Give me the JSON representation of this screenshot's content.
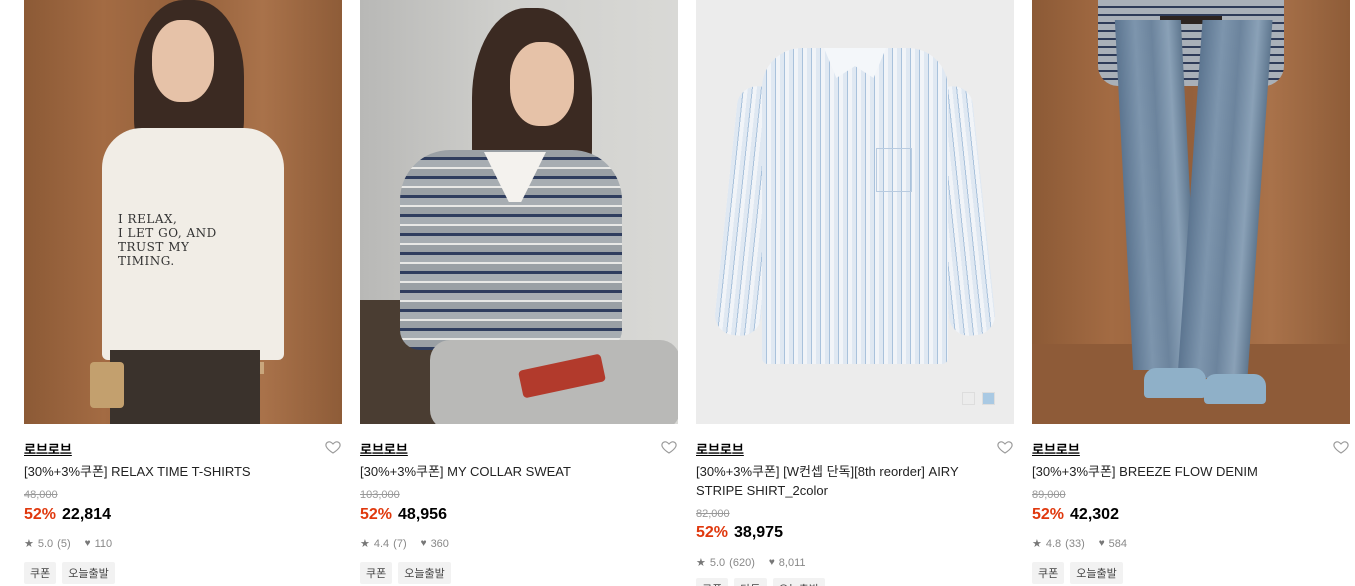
{
  "products": [
    {
      "brand": "로브로브",
      "title": "[30%+3%쿠폰] RELAX TIME T-SHIRTS",
      "original_price": "48,000",
      "discount": "52%",
      "sale_price": "22,814",
      "rating": "5.0",
      "reviews": "(5)",
      "likes": "110",
      "tags": [
        "쿠폰",
        "오늘출발"
      ],
      "print_text": "I RELAX,\nI LET GO, AND\nTRUST MY\nTIMING."
    },
    {
      "brand": "로브로브",
      "title": "[30%+3%쿠폰] MY COLLAR SWEAT",
      "original_price": "103,000",
      "discount": "52%",
      "sale_price": "48,956",
      "rating": "4.4",
      "reviews": "(7)",
      "likes": "360",
      "tags": [
        "쿠폰",
        "오늘출발"
      ]
    },
    {
      "brand": "로브로브",
      "title": "[30%+3%쿠폰] [W컨셉 단독][8th reorder] AIRY STRIPE SHIRT_2color",
      "original_price": "82,000",
      "discount": "52%",
      "sale_price": "38,975",
      "rating": "5.0",
      "reviews": "(620)",
      "likes": "8,011",
      "tags": [
        "쿠폰",
        "단독",
        "오늘출발"
      ],
      "swatch_colors": [
        "#ffffff",
        "#a9c9e3"
      ]
    },
    {
      "brand": "로브로브",
      "title": "[30%+3%쿠폰] BREEZE FLOW DENIM",
      "original_price": "89,000",
      "discount": "52%",
      "sale_price": "42,302",
      "rating": "4.8",
      "reviews": "(33)",
      "likes": "584",
      "tags": [
        "쿠폰",
        "오늘출발"
      ]
    }
  ],
  "icons": {
    "heart": "heart-outline-icon",
    "star": "star-icon",
    "like": "heart-filled-icon"
  },
  "colors": {
    "discount": "#e0380d",
    "brand_text": "#000000",
    "muted": "#888888"
  }
}
